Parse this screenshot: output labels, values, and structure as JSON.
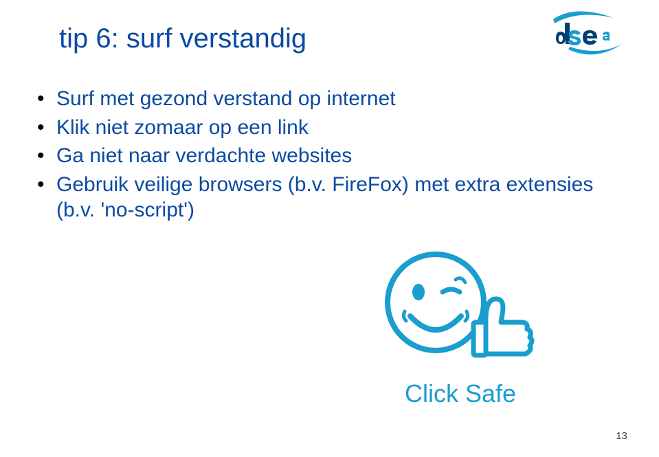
{
  "colors": {
    "text_primary": "#0b4aa2",
    "accent_cyan": "#1a9dcf",
    "logo_dark": "#004173",
    "logo_light": "#1a9dcf"
  },
  "logo": {
    "name": "dse"
  },
  "title": "tip 6: surf verstandig",
  "bullets": [
    "Surf met gezond verstand op internet",
    "Klik niet zomaar op een link",
    "Ga niet naar verdachte websites",
    "Gebruik veilige browsers (b.v. FireFox) met extra extensies (b.v. 'no-script')"
  ],
  "illustration_label": "Click Safe",
  "page_number": "13"
}
